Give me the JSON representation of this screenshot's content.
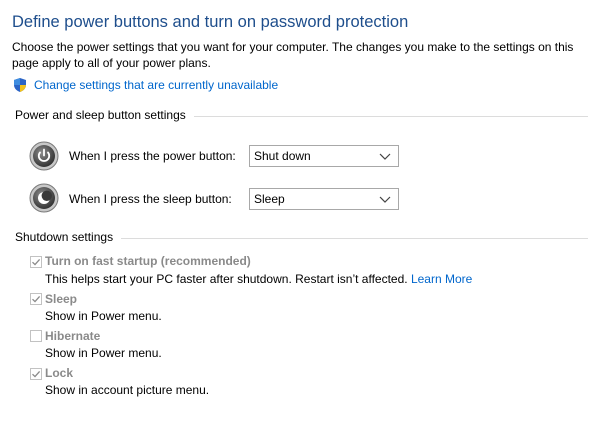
{
  "page": {
    "title": "Define power buttons and turn on password protection",
    "description": "Choose the power settings that you want for your computer. The changes you make to the settings on this page apply to all of your power plans.",
    "change_settings_link": "Change settings that are currently unavailable"
  },
  "power_sleep": {
    "section_title": "Power and sleep button settings",
    "power_label": "When I press the power button:",
    "power_value": "Shut down",
    "sleep_label": "When I press the sleep button:",
    "sleep_value": "Sleep"
  },
  "shutdown": {
    "section_title": "Shutdown settings",
    "items": [
      {
        "label": "Turn on fast startup (recommended)",
        "desc": "This helps start your PC faster after shutdown. Restart isn’t affected.",
        "link": "Learn More",
        "checked": true
      },
      {
        "label": "Sleep",
        "desc": "Show in Power menu.",
        "checked": true
      },
      {
        "label": "Hibernate",
        "desc": "Show in Power menu.",
        "checked": false
      },
      {
        "label": "Lock",
        "desc": "Show in account picture menu.",
        "checked": true
      }
    ]
  },
  "colors": {
    "title": "#1e4e8c",
    "link": "#0066cc",
    "disabled_label": "#8a8a8a"
  },
  "icons": [
    "uac-shield-icon",
    "power-button-icon",
    "sleep-button-icon",
    "checkmark-icon",
    "chevron-down-icon"
  ]
}
